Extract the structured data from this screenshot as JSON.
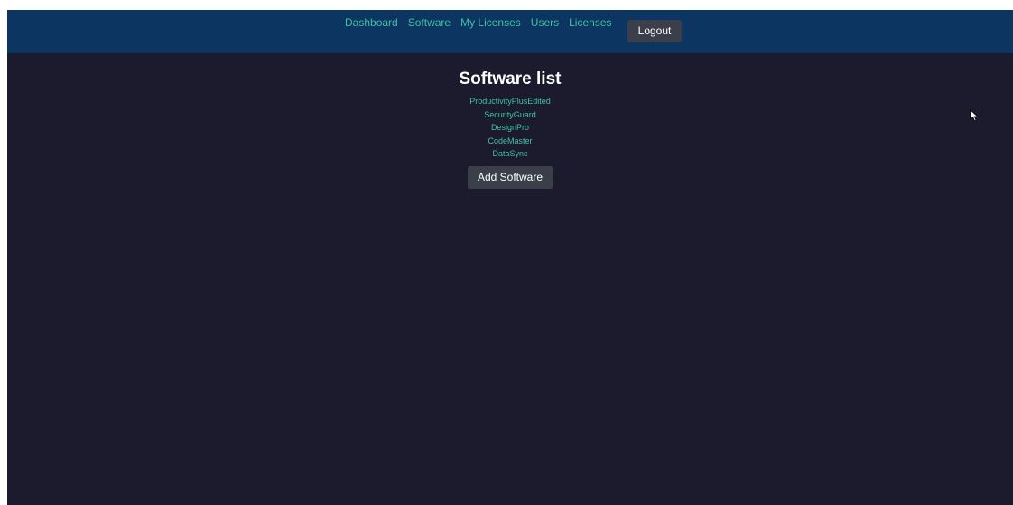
{
  "navbar": {
    "links": [
      {
        "label": "Dashboard"
      },
      {
        "label": "Software"
      },
      {
        "label": "My Licenses"
      },
      {
        "label": "Users"
      },
      {
        "label": "Licenses"
      }
    ],
    "logout_label": "Logout"
  },
  "main": {
    "title": "Software list",
    "software": [
      {
        "name": "ProductivityPlusEdited"
      },
      {
        "name": "SecurityGuard"
      },
      {
        "name": "DesignPro"
      },
      {
        "name": "CodeMaster"
      },
      {
        "name": "DataSync"
      }
    ],
    "add_label": "Add Software"
  },
  "colors": {
    "navbar_bg": "#0c3562",
    "page_bg": "#1b1b2d",
    "link": "#3ec3a0",
    "button_bg": "#3a3f4a"
  },
  "icons": {
    "cursor": "mouse-pointer-icon"
  }
}
